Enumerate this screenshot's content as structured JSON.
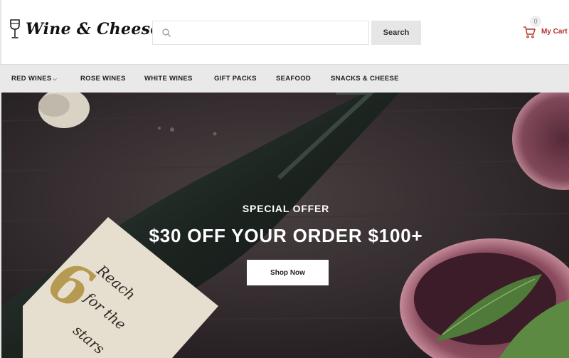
{
  "brand": {
    "name": "Wine & Cheese",
    "icon": "wine-glass-icon"
  },
  "search": {
    "placeholder": "",
    "value": "",
    "button_label": "Search",
    "icon": "search-icon"
  },
  "cart": {
    "label": "My Cart",
    "count": "0",
    "icon": "cart-icon"
  },
  "nav": {
    "items": [
      {
        "label": "RED WINES",
        "has_dropdown": true
      },
      {
        "label": "ROSE WINES",
        "has_dropdown": false
      },
      {
        "label": "WHITE WINES",
        "has_dropdown": false
      },
      {
        "label": "GIFT PACKS",
        "has_dropdown": false
      },
      {
        "label": "SEAFOOD",
        "has_dropdown": false
      },
      {
        "label": "SNACKS & CHEESE",
        "has_dropdown": false
      }
    ]
  },
  "hero": {
    "kicker": "SPECIAL OFFER",
    "title": "$30 OFF YOUR ORDER $100+",
    "button_label": "Shop Now",
    "bottle_label": {
      "number": "6",
      "lines": [
        "Reach",
        "for the",
        "stars"
      ]
    }
  },
  "colors": {
    "accent": "#b5332e",
    "nav_bg": "#e9e9e9",
    "hero_bg": "#2c2527"
  }
}
